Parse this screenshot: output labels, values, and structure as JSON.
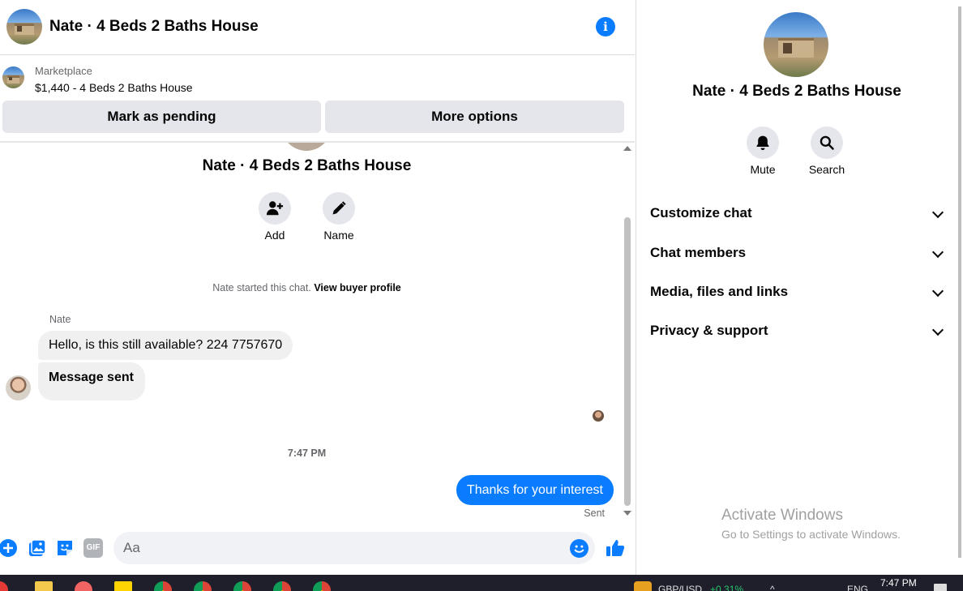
{
  "header": {
    "title": "Nate · 4 Beds 2 Baths House",
    "info_icon": "info-icon"
  },
  "marketplace": {
    "label": "Marketplace",
    "listing": "$1,440 - 4 Beds 2 Baths House",
    "mark_pending": "Mark as pending",
    "more_options": "More options"
  },
  "thread": {
    "title": "Nate · 4 Beds 2 Baths House",
    "add_label": "Add",
    "name_label": "Name",
    "started_text": "Nate started this chat.",
    "view_profile": "View buyer profile",
    "sender": "Nate",
    "messages_in": [
      "Hello, is this still available? 224 7757670",
      "Message sent"
    ],
    "time_separator": "7:47 PM",
    "message_out": "Thanks for your interest",
    "sent_status": "Sent"
  },
  "composer": {
    "placeholder": "Aa",
    "gif": "GIF"
  },
  "info_panel": {
    "title": "Nate · 4 Beds 2 Baths House",
    "mute": "Mute",
    "search": "Search",
    "sections": [
      "Customize chat",
      "Chat members",
      "Media, files and links",
      "Privacy & support"
    ]
  },
  "watermark": {
    "line1": "Activate Windows",
    "line2": "Go to Settings to activate Windows."
  },
  "taskbar": {
    "ticker": "GBP/USD",
    "change": "+0.31%",
    "lang": "ENG",
    "clock": "7:47 PM"
  },
  "colors": {
    "accent": "#0a7cff",
    "bubble_in": "#f0f0f0",
    "button_gray": "#e4e6eb"
  }
}
